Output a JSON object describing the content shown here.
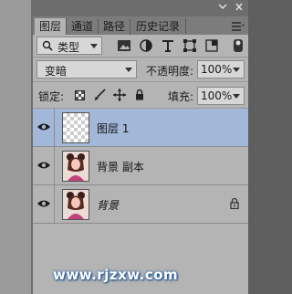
{
  "tabs": [
    {
      "label": "图层",
      "active": true
    },
    {
      "label": "通道",
      "active": false
    },
    {
      "label": "路径",
      "active": false
    },
    {
      "label": "历史记录",
      "active": false
    }
  ],
  "filter": {
    "kind_label": "类型",
    "icons": [
      "image-filter-icon",
      "adjustment-filter-icon",
      "type-filter-icon",
      "shape-filter-icon",
      "smart-object-filter-icon"
    ]
  },
  "blend": {
    "mode": "变暗",
    "opacity_label": "不透明度:",
    "opacity_value": "100%"
  },
  "lock": {
    "label": "锁定:",
    "fill_label": "填充:",
    "fill_value": "100%",
    "icons": [
      "lock-transparency-icon",
      "lock-paint-icon",
      "lock-position-icon",
      "lock-all-icon"
    ]
  },
  "layers": [
    {
      "name": "图层 1",
      "selected": true,
      "locked": false,
      "thumb": "transparent"
    },
    {
      "name": "背景 副本",
      "selected": false,
      "locked": false,
      "thumb": "photo"
    },
    {
      "name": "背景",
      "selected": false,
      "locked": true,
      "thumb": "photo",
      "italic": true
    }
  ],
  "watermark": "www.rjzxw.com",
  "colors": {
    "panel_bg": "#b4b4b4",
    "selected_row": "#a3b8d9",
    "tab_bar": "#7c7c7c",
    "outer_bg": "#5f5f5f"
  }
}
